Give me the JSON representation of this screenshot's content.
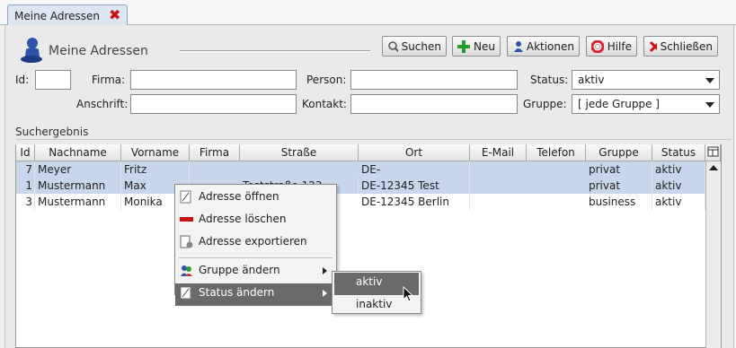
{
  "tab": {
    "label": "Meine Adressen"
  },
  "header": {
    "title": "Meine Adressen"
  },
  "toolbar": {
    "search": "Suchen",
    "new": "Neu",
    "actions": "Aktionen",
    "help": "Hilfe",
    "close": "Schließen"
  },
  "form": {
    "id_label": "Id:",
    "firma_label": "Firma:",
    "person_label": "Person:",
    "status_label": "Status:",
    "status_value": "aktiv",
    "anschrift_label": "Anschrift:",
    "kontakt_label": "Kontakt:",
    "gruppe_label": "Gruppe:",
    "gruppe_value": "[ jede Gruppe ]"
  },
  "results": {
    "title": "Suchergebnis",
    "columns": [
      "Id",
      "Nachname",
      "Vorname",
      "Firma",
      "Straße",
      "Ort",
      "E-Mail",
      "Telefon",
      "Gruppe",
      "Status"
    ],
    "rows": [
      {
        "id": "7",
        "nachname": "Meyer",
        "vorname": "Fritz",
        "firma": "",
        "strasse": "",
        "ort": "DE-",
        "email": "",
        "telefon": "",
        "gruppe": "privat",
        "status": "aktiv"
      },
      {
        "id": "1",
        "nachname": "Mustermann",
        "vorname": "Max",
        "firma": "",
        "strasse": "Teststraße 123",
        "ort": "DE-12345 Test",
        "email": "",
        "telefon": "",
        "gruppe": "privat",
        "status": "aktiv"
      },
      {
        "id": "3",
        "nachname": "Mustermann",
        "vorname": "Monika",
        "firma": "",
        "strasse": "",
        "ort": "DE-12345 Berlin",
        "email": "",
        "telefon": "",
        "gruppe": "business",
        "status": "aktiv"
      }
    ]
  },
  "context_menu": {
    "open": "Adresse öffnen",
    "delete": "Adresse löschen",
    "export": "Adresse exportieren",
    "change_group": "Gruppe ändern",
    "change_status": "Status ändern"
  },
  "status_submenu": {
    "active": "aktiv",
    "inactive": "inaktiv"
  },
  "colors": {
    "selection": "#c7d6ea",
    "menu_highlight": "#6a6a6a",
    "close_red": "#d01010",
    "plus_green": "#2a9a2a"
  }
}
